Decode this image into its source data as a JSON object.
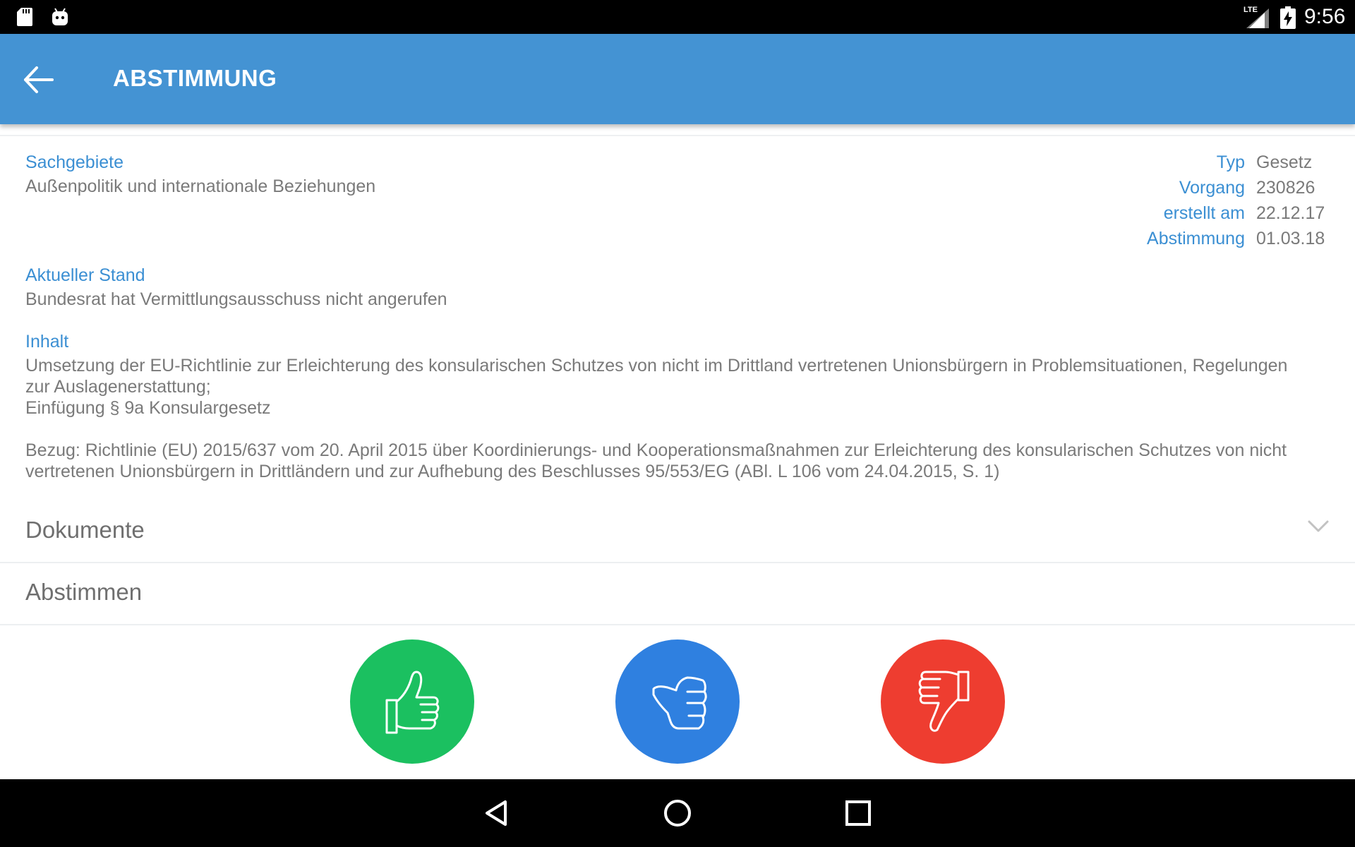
{
  "status_bar": {
    "time": "9:56",
    "network": "LTE"
  },
  "app_bar": {
    "title": "ABSTIMMUNG"
  },
  "details": {
    "sachgebiete_label": "Sachgebiete",
    "sachgebiete_value": "Außenpolitik und internationale Beziehungen",
    "meta": [
      {
        "key": "Typ",
        "value": "Gesetz"
      },
      {
        "key": "Vorgang",
        "value": "230826"
      },
      {
        "key": "erstellt am",
        "value": "22.12.17"
      },
      {
        "key": "Abstimmung",
        "value": "01.03.18"
      }
    ],
    "stand_label": "Aktueller Stand",
    "stand_value": "Bundesrat hat Vermittlungsausschuss nicht angerufen",
    "inhalt_label": "Inhalt",
    "inhalt_line1": "Umsetzung der EU-Richtlinie zur Erleichterung des konsularischen Schutzes von nicht im Drittland vertretenen Unionsbürgern in Problemsituationen, Regelungen",
    "inhalt_line2": "zur Auslagenerstattung;",
    "inhalt_line3": "Einfügung § 9a Konsulargesetz",
    "bezug_line1": "Bezug: Richtlinie (EU) 2015/637 vom 20. April 2015 über Koordinierungs- und Kooperationsmaßnahmen zur Erleichterung des konsularischen Schutzes von nicht",
    "bezug_line2": "vertretenen Unionsbürgern in Drittländern und zur Aufhebung des Beschlusses 95/553/EG (ABl. L 106 vom 24.04.2015, S. 1)"
  },
  "sections": {
    "dokumente": "Dokumente",
    "abstimmen": "Abstimmen"
  },
  "vote_buttons": {
    "yes": {
      "icon": "thumbs-up-icon",
      "color": "#1bc060"
    },
    "abstain": {
      "icon": "thumb-sideways-icon",
      "color": "#2f80e0"
    },
    "no": {
      "icon": "thumbs-down-icon",
      "color": "#ee3d30"
    }
  },
  "colors": {
    "app_bar": "#4493d3",
    "label": "#3b8fd3",
    "text": "#7a7a7a"
  }
}
